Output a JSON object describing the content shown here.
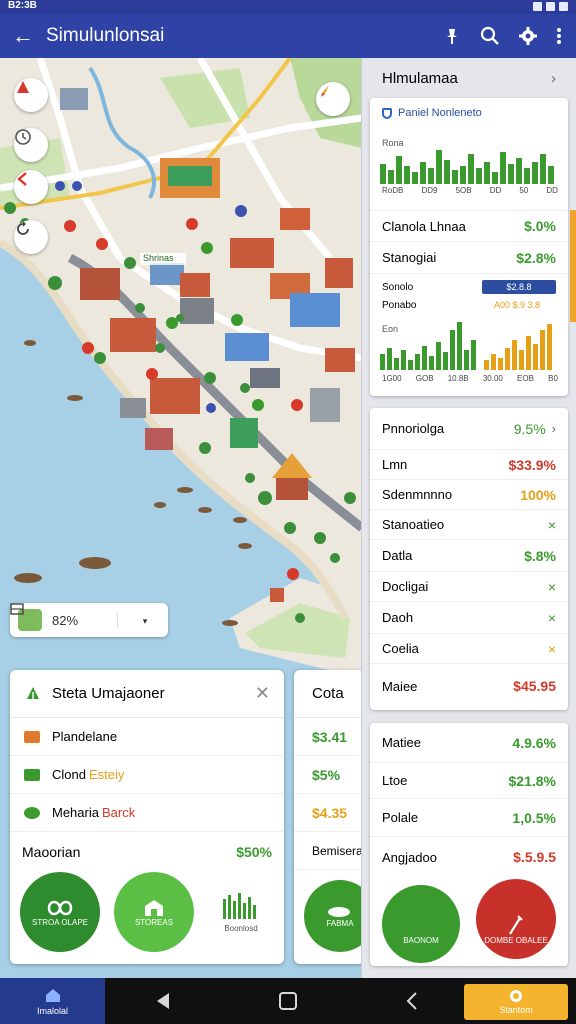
{
  "status_bar": {
    "time": "B2:3B"
  },
  "app_bar": {
    "title": "Simulunlonsai",
    "back_icon": "arrow-back-icon"
  },
  "colors": {
    "primary": "#2f42a5",
    "green": "#3a9a2e",
    "red": "#d03a2a",
    "orange": "#e6a018",
    "water": "#a7cfe6"
  },
  "map": {
    "place_label": "Shrinas",
    "zoom_level": "82%",
    "layer_icon": "layers-icon"
  },
  "info_card": {
    "title": "Steta Umajaoner",
    "rows": [
      {
        "label": "Plandelane",
        "accent": ""
      },
      {
        "label": "Clond",
        "accent": "Esteiy"
      },
      {
        "label": "Meharia",
        "accent": "Barck"
      }
    ],
    "summary_label": "Maoorian",
    "summary_value": "$50%",
    "circles": [
      "STROA OLAPE",
      "STOREAS",
      ""
    ],
    "bars_caption": "Boonlosd"
  },
  "cota_card": {
    "title": "Cota",
    "values": [
      "$3.41",
      "$5%",
      "$4.35",
      "Bemisera"
    ],
    "circle_label": "FABMA"
  },
  "right_panel": {
    "header": "Hlmulamaa",
    "card1": {
      "title": "Paniel Nonleneto",
      "chart_label": "Rona",
      "chart1_ticks": [
        "RoDB",
        "DD9",
        "5OB",
        "DD",
        "50",
        "DD"
      ],
      "rows": [
        {
          "label": "Clanola Lhnaa",
          "value": "$.0%"
        },
        {
          "label": "Stanogiai",
          "value": "$2.8%"
        }
      ],
      "legend1_label": "Sonolo",
      "legend1_badge": "$2.8.8",
      "legend2_label": "Ponabo",
      "legend2_value": "A00 $.9 3.8",
      "chart2_label": "Eon",
      "chart2_ticks": [
        "1G00",
        "GOB",
        "10.8B",
        "30.00",
        "EOB",
        "B0"
      ]
    },
    "card2": {
      "rows": [
        {
          "label": "Pnnoriolga",
          "value": "9.5%"
        },
        {
          "label": "Lmn",
          "value": "$33.9%"
        },
        {
          "label": "Sdenmnnno",
          "value": "100%"
        },
        {
          "label": "Stanoatieo",
          "value": "×"
        },
        {
          "label": "Datla",
          "value": "$.8%"
        },
        {
          "label": "Docligai",
          "value": "×"
        },
        {
          "label": "Daoh",
          "value": "×"
        },
        {
          "label": "Coelia",
          "value": "×"
        },
        {
          "label": "Maiee",
          "value": "$45.95"
        }
      ]
    },
    "card3": {
      "rows": [
        {
          "label": "Matiee",
          "value": "4.9.6%"
        },
        {
          "label": "Ltoe",
          "value": "$21.8%"
        },
        {
          "label": "Polale",
          "value": "1,0.5%"
        },
        {
          "label": "Angjadoo",
          "value": "$.5.9.5"
        }
      ],
      "circle_left_label": "BAONOM",
      "circle_right_label": "DOMBE OBALEE"
    }
  },
  "nav": {
    "home_label": "Imalolal",
    "right_label": "Stantom"
  }
}
